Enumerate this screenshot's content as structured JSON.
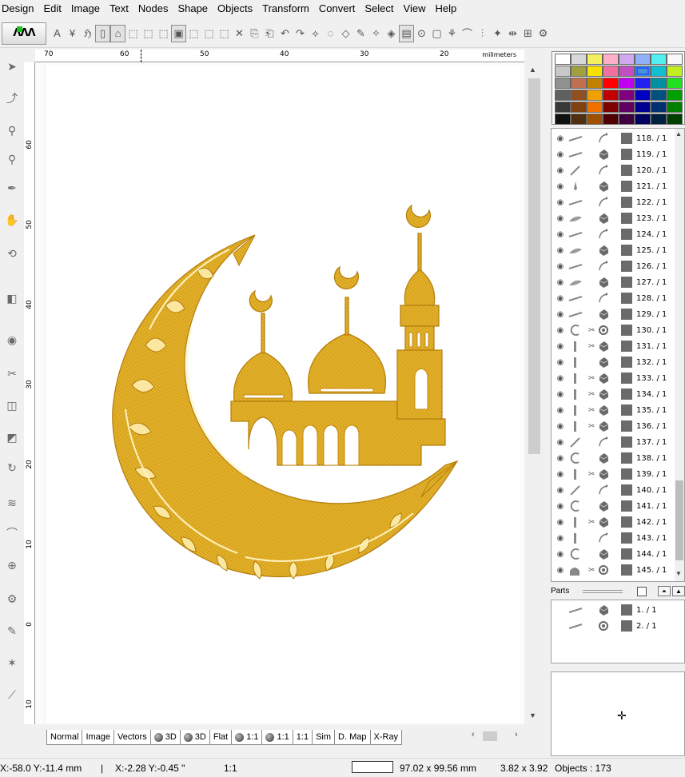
{
  "menu": [
    "Design",
    "Edit",
    "Image",
    "Text",
    "Nodes",
    "Shape",
    "Objects",
    "Transform",
    "Convert",
    "Select",
    "View",
    "Help"
  ],
  "ruler": {
    "unit": "milimeters",
    "top_labels": [
      "70",
      "60",
      "50",
      "40",
      "30",
      "20"
    ],
    "left_labels": [
      "60",
      "50",
      "40",
      "30",
      "20",
      "10",
      "0",
      "10"
    ]
  },
  "tabs": [
    "Normal",
    "Image",
    "Vectors",
    "3D",
    "3D",
    "Flat",
    "1:1",
    "1:1",
    "1:1",
    "Sim",
    "D. Map",
    "X-Ray"
  ],
  "palette": {
    "selected_color": "#4a8fd8",
    "rows": [
      [
        "#ffffff",
        "#d8d8d8",
        "#f4f060",
        "#ffb0c8",
        "#d0a8f0",
        "#90b0f8",
        "#50f0f0",
        "#f8f8f8"
      ],
      [
        "#c8c8c8",
        "#a0a040",
        "#f8e000",
        "#f070a0",
        "#c050c0",
        "#4a8fd8",
        "#10c0d0",
        "#c0f020"
      ],
      [
        "#909090",
        "#c07050",
        "#c08000",
        "#ff0000",
        "#c000f0",
        "#2020f0",
        "#0090a0",
        "#20e020"
      ],
      [
        "#606060",
        "#905020",
        "#f0a000",
        "#c00000",
        "#800080",
        "#0000c0",
        "#005080",
        "#00a000"
      ],
      [
        "#383838",
        "#804010",
        "#f07000",
        "#800000",
        "#600060",
        "#000090",
        "#003070",
        "#008000"
      ],
      [
        "#101010",
        "#503010",
        "#a05000",
        "#500000",
        "#400040",
        "#000060",
        "#002040",
        "#004000"
      ]
    ]
  },
  "objects": [
    {
      "label": "118.  / 1",
      "thumb": "line",
      "kind": "curve",
      "cut": false
    },
    {
      "label": "119.  / 1",
      "thumb": "line",
      "kind": "fill",
      "cut": false
    },
    {
      "label": "120.  / 1",
      "thumb": "slash",
      "kind": "curve",
      "cut": false
    },
    {
      "label": "121.  / 1",
      "thumb": "drop",
      "kind": "fill",
      "cut": false
    },
    {
      "label": "122.  / 1",
      "thumb": "line",
      "kind": "curve",
      "cut": false
    },
    {
      "label": "123.  / 1",
      "thumb": "leaf",
      "kind": "fill",
      "cut": false
    },
    {
      "label": "124.  / 1",
      "thumb": "line",
      "kind": "curve",
      "cut": false
    },
    {
      "label": "125.  / 1",
      "thumb": "leaf",
      "kind": "fill",
      "cut": false
    },
    {
      "label": "126.  / 1",
      "thumb": "line",
      "kind": "curve",
      "cut": false
    },
    {
      "label": "127.  / 1",
      "thumb": "leaf",
      "kind": "fill",
      "cut": false
    },
    {
      "label": "128.  / 1",
      "thumb": "line",
      "kind": "curve",
      "cut": false
    },
    {
      "label": "129.  / 1",
      "thumb": "line",
      "kind": "fill",
      "cut": false
    },
    {
      "label": "130.  / 1",
      "thumb": "arc",
      "kind": "gear",
      "cut": true
    },
    {
      "label": "131.  / 1",
      "thumb": "bar",
      "kind": "fill",
      "cut": true
    },
    {
      "label": "132.  / 1",
      "thumb": "bar",
      "kind": "fill",
      "cut": false
    },
    {
      "label": "133.  / 1",
      "thumb": "bar",
      "kind": "fill",
      "cut": true
    },
    {
      "label": "134.  / 1",
      "thumb": "bar",
      "kind": "fill",
      "cut": true
    },
    {
      "label": "135.  / 1",
      "thumb": "bar",
      "kind": "fill",
      "cut": true
    },
    {
      "label": "136.  / 1",
      "thumb": "bar",
      "kind": "fill",
      "cut": true
    },
    {
      "label": "137.  / 1",
      "thumb": "slash",
      "kind": "curve",
      "cut": false
    },
    {
      "label": "138.  / 1",
      "thumb": "arc",
      "kind": "fill",
      "cut": false
    },
    {
      "label": "139.  / 1",
      "thumb": "bar",
      "kind": "fill",
      "cut": true
    },
    {
      "label": "140.  / 1",
      "thumb": "slash",
      "kind": "curve",
      "cut": false
    },
    {
      "label": "141.  / 1",
      "thumb": "arc",
      "kind": "fill",
      "cut": false
    },
    {
      "label": "142.  / 1",
      "thumb": "bar",
      "kind": "fill",
      "cut": true
    },
    {
      "label": "143.  / 1",
      "thumb": "bar",
      "kind": "curve",
      "cut": false
    },
    {
      "label": "144.  / 1",
      "thumb": "arc",
      "kind": "fill",
      "cut": false
    },
    {
      "label": "145.  / 1",
      "thumb": "mosque",
      "kind": "gear",
      "cut": true
    }
  ],
  "parts": {
    "label": "Parts",
    "items": [
      {
        "label": "1.  / 1",
        "kind": "fill"
      },
      {
        "label": "2.  / 1",
        "kind": "gear"
      }
    ]
  },
  "status": {
    "pos1": "X:-58.0  Y:-11.4 mm",
    "sep": "|",
    "pos2": "X:-2.28  Y:-0.45 \"",
    "zoom": "1:1",
    "size_mm": "97.02 x 99.56 mm",
    "size_in": "3.82 x 3.92",
    "objects": "Objects : 173"
  },
  "design_colors": {
    "gold": "#e3b022",
    "gold_dark": "#b47d0a",
    "gold_light": "#f6d468"
  }
}
